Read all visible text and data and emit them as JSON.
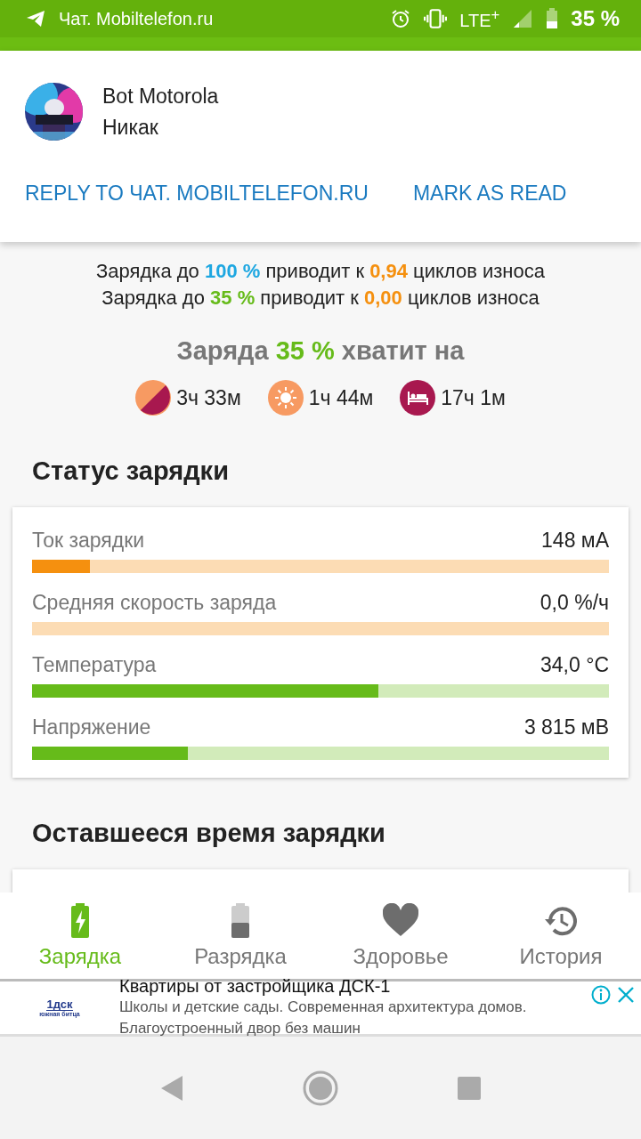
{
  "status_bar": {
    "app_title": "Чат. Mobiltelefon.ru",
    "network": "LTE$^{+}$",
    "battery": "35 %"
  },
  "notification": {
    "sender": "Bot Motorola",
    "message": "Никак",
    "actions": [
      "REPLY TO ЧАТ. MOBILTELEFON.RU",
      "MARK AS READ"
    ]
  },
  "wear": {
    "lines": [
      {
        "parts": [
          {
            "text": "Зарядка до "
          },
          {
            "text": "100 %",
            "color": "#1ea7e1"
          },
          {
            "text": " приводит к "
          },
          {
            "text": "0,94",
            "color": "#f5900f"
          },
          {
            "text": " циклов износа"
          }
        ]
      },
      {
        "parts": [
          {
            "text": "Зарядка до "
          },
          {
            "text": "35 %",
            "color": "#66bb1a"
          },
          {
            "text": " приводит к "
          },
          {
            "text": "0,00",
            "color": "#f5900f"
          },
          {
            "text": " циклов износа"
          }
        ]
      }
    ]
  },
  "estimate": {
    "title_parts": [
      {
        "text": "Заряда "
      },
      {
        "text": "35 %",
        "color": "#66bb1a"
      },
      {
        "text": " хватит на"
      }
    ],
    "items": [
      {
        "kind": "mixed",
        "time": "3ч 33м"
      },
      {
        "kind": "screen",
        "time": "1ч 44м"
      },
      {
        "kind": "sleep",
        "time": "17ч 1м"
      }
    ]
  },
  "charging_status": {
    "heading": "Статус зарядки",
    "metrics": [
      {
        "kind": "rate",
        "label": "Ток зарядки",
        "value": "148 мА",
        "level": 0.1
      },
      {
        "kind": "rate",
        "label": "Средняя скорость заряда",
        "value": "0,0 %/ч"
      },
      {
        "kind": "sensor",
        "label": "Температура",
        "value": "34,0 °C",
        "level": 0.6
      },
      {
        "kind": "sensor",
        "label": "Напряжение",
        "value": "3 815 мВ",
        "level": 0.27
      }
    ]
  },
  "remaining": {
    "heading": "Оставшееся время зарядки"
  },
  "tabs": [
    {
      "label": "Зарядка",
      "kind": "charge",
      "selected": true
    },
    {
      "label": "Разрядка",
      "kind": "discharge",
      "selected": false
    },
    {
      "label": "Здоровье",
      "kind": "health",
      "selected": false
    },
    {
      "label": "История",
      "kind": "history",
      "selected": false
    }
  ],
  "ad": {
    "logo_mark": "1дск",
    "logo_text": "южная битца",
    "title": "Квартиры от застройщика ДСК-1",
    "text": "Школы и детские сады. Современная архитектура домов. Благоустроенный двор без машин"
  }
}
